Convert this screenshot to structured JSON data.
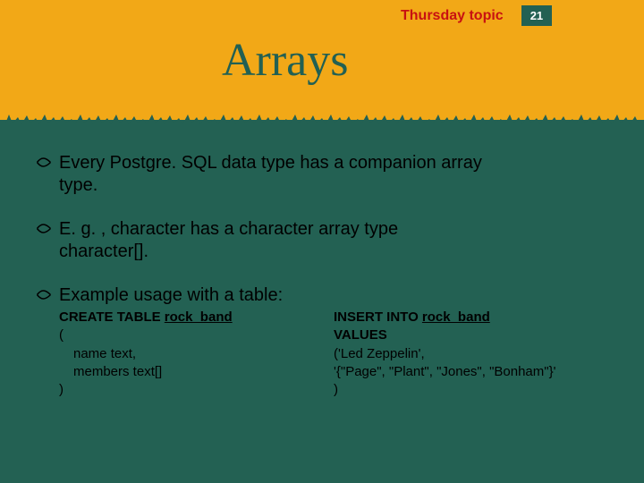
{
  "header": {
    "topic_label": "Thursday topic",
    "page_number": "21",
    "title": "Arrays"
  },
  "bullets": {
    "b1_line1": "Every Postgre. SQL data type has a companion array",
    "b1_line2": "type.",
    "b2_line1": "E. g. , character has a character array type",
    "b2_line2": "character[].",
    "b3": "Example usage with a table:"
  },
  "code_left": {
    "l1_bold": "CREATE TABLE ",
    "l1_u": "rock_band",
    "l2": "(",
    "l3": "name text,",
    "l4": "members text[]",
    "l5": ")"
  },
  "code_right": {
    "r1_bold": "INSERT INTO ",
    "r1_u": "rock_band",
    "r2": "VALUES",
    "r3": "('Led Zeppelin',",
    "r4": "'{\"Page\", \"Plant\", \"Jones\", \"Bonham\"}'",
    "r5": ")"
  }
}
